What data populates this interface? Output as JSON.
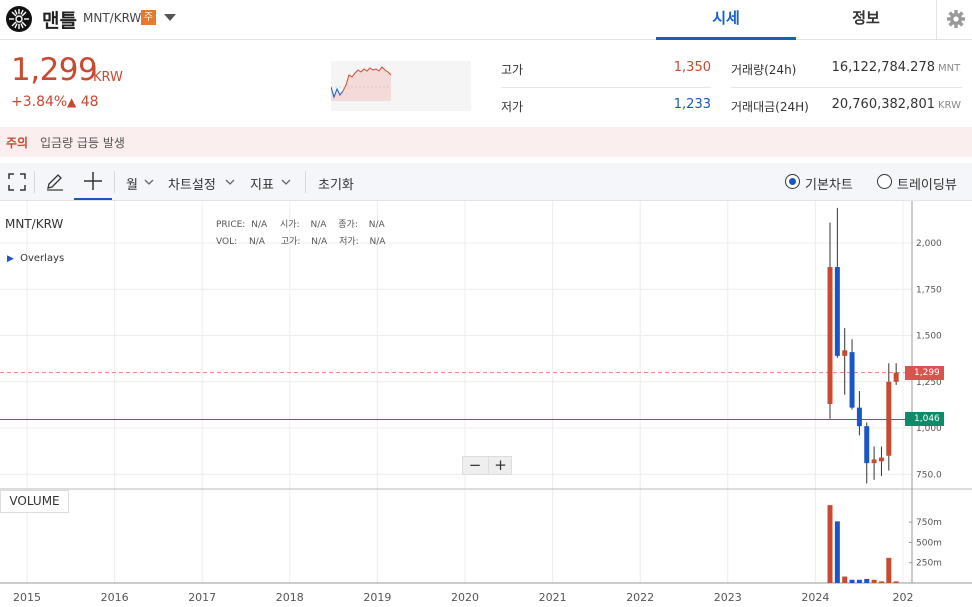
{
  "header": {
    "coin_name": "맨틀",
    "pair": "MNT/KRW",
    "badge": "주",
    "tabs": [
      {
        "label": "시세",
        "active": true
      },
      {
        "label": "정보",
        "active": false
      }
    ]
  },
  "ticker": {
    "price": "1,299",
    "unit": "KRW",
    "change_pct": "+3.84%",
    "change_arrow": "▲",
    "change_amount": "48",
    "high_label": "고가",
    "high_value": "1,350",
    "low_label": "저가",
    "low_value": "1,233",
    "volume_label": "거래량(24h)",
    "volume_value": "16,122,784.278",
    "volume_unit": "MNT",
    "turnover_label": "거래대금(24H)",
    "turnover_value": "20,760,382,801",
    "turnover_unit": "KRW"
  },
  "alert": {
    "tag": "주의",
    "message": "입금량 급등 발생"
  },
  "toolbar": {
    "period": "월",
    "chart_settings": "차트설정",
    "indicators": "지표",
    "reset": "초기화",
    "view_basic": "기본차트",
    "view_trading": "트레이딩뷰",
    "selected_view": "기본차트"
  },
  "chart": {
    "symbol": "MNT/KRW",
    "overlays": "Overlays",
    "price_label": "PRICE:",
    "price_val": "N/A",
    "open_label": "시가:",
    "open_val": "N/A",
    "close_label": "종가:",
    "close_val": "N/A",
    "vol_label": "VOL:",
    "vol_val": "N/A",
    "high_label": "고가:",
    "high_val": "N/A",
    "low_label": "저가:",
    "low_val": "N/A",
    "volume_button": "VOLUME",
    "zoom_out": "−",
    "zoom_in": "+",
    "current_price_tag": "1,299",
    "reference_tag": "1,046"
  },
  "colors": {
    "up": "#c84a31",
    "down": "#1a57c6",
    "accent": "#1460c8",
    "reference_line": "#0f8a6b"
  },
  "chart_data": {
    "type": "candlestick",
    "x_tick_labels": [
      "2015",
      "2016",
      "2017",
      "2018",
      "2019",
      "2020",
      "2021",
      "2022",
      "2023",
      "2024",
      "202"
    ],
    "y_tick_labels": [
      "750.0",
      "1,000",
      "1,250",
      "1,500",
      "1,750",
      "2,000"
    ],
    "volume_tick_labels": [
      "250m",
      "500m",
      "750m"
    ],
    "ylim": [
      640,
      2230
    ],
    "current_price": 1299,
    "reference_line": 1046,
    "candles": [
      {
        "t": "2024-03",
        "open": 1130,
        "high": 2110,
        "low": 1050,
        "close": 1870
      },
      {
        "t": "2024-04",
        "open": 1870,
        "high": 2190,
        "low": 1380,
        "close": 1390
      },
      {
        "t": "2024-05",
        "open": 1390,
        "high": 1540,
        "low": 1180,
        "close": 1420
      },
      {
        "t": "2024-06",
        "open": 1410,
        "high": 1480,
        "low": 1100,
        "close": 1110
      },
      {
        "t": "2024-07",
        "open": 1110,
        "high": 1200,
        "low": 960,
        "close": 1010
      },
      {
        "t": "2024-08",
        "open": 1010,
        "high": 1030,
        "low": 700,
        "close": 810
      },
      {
        "t": "2024-09",
        "open": 810,
        "high": 900,
        "low": 720,
        "close": 830
      },
      {
        "t": "2024-10",
        "open": 820,
        "high": 900,
        "low": 740,
        "close": 840
      },
      {
        "t": "2024-11",
        "open": 850,
        "high": 1350,
        "low": 770,
        "close": 1250
      },
      {
        "t": "2024-12",
        "open": 1250,
        "high": 1350,
        "low": 1233,
        "close": 1299
      }
    ],
    "volume": [
      960,
      760,
      80,
      40,
      40,
      50,
      40,
      20,
      310,
      20
    ]
  }
}
